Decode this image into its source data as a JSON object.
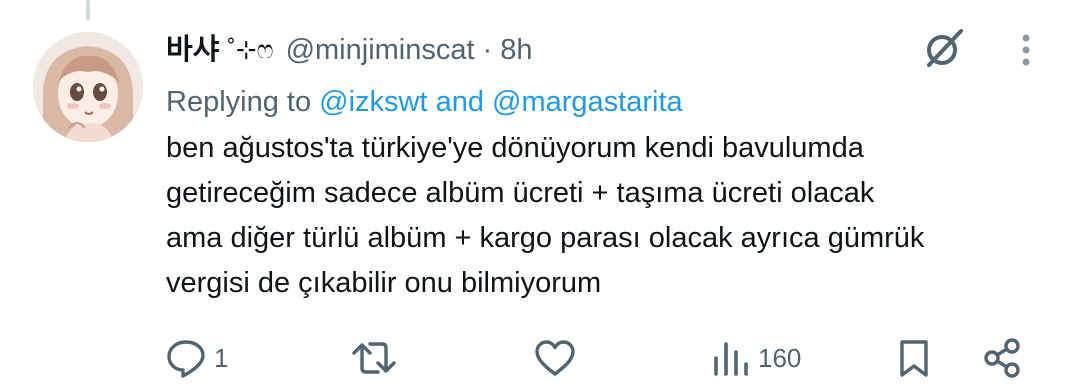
{
  "tweet": {
    "display_name": "바샤",
    "name_decoration": "˚⊹ෆ",
    "handle": "@minjiminscat",
    "separator": "·",
    "time": "8h",
    "replying_prefix": "Replying to",
    "replying_to": "@izkswt and @margastarita",
    "text_lines": [
      "ben ağustos'ta türkiye'ye dönüyorum kendi bavulumda",
      "getireceğim sadece albüm ücreti + taşıma ücreti olacak",
      "ama diğer türlü albüm + kargo parası olacak ayrıca gümrük",
      "vergisi de çıkabilir onu bilmiyorum"
    ]
  },
  "actions": {
    "reply_count": "1",
    "retweet_count": "",
    "like_count": "",
    "views_count": "160"
  },
  "icons": {
    "avatar": "avatar-illustration",
    "grok": "grok-icon",
    "more": "more-options-icon",
    "reply": "reply-icon",
    "retweet": "retweet-icon",
    "like": "heart-icon",
    "views": "analytics-icon",
    "bookmark": "bookmark-icon",
    "share": "share-icon"
  },
  "colors": {
    "text": "#0f1419",
    "secondary": "#536471",
    "link": "#1d9bf0",
    "divider": "#cfd9de"
  }
}
